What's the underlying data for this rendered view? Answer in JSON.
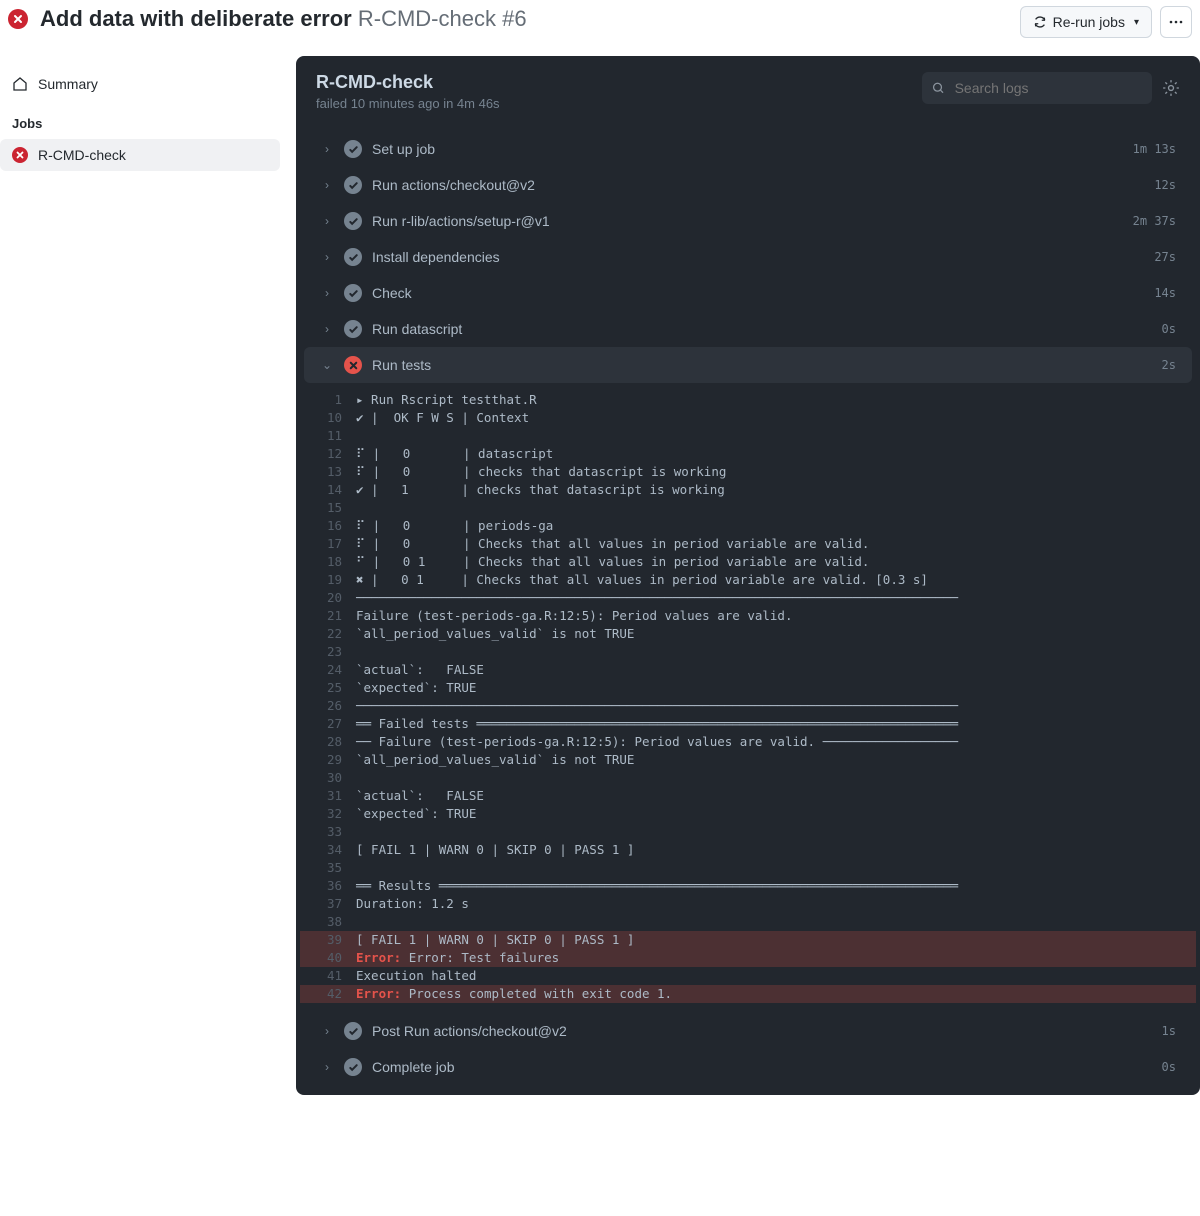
{
  "header": {
    "title": "Add data with deliberate error",
    "subtitle": "R-CMD-check #6",
    "rerun_label": "Re-run jobs"
  },
  "sidebar": {
    "summary_label": "Summary",
    "jobs_label": "Jobs",
    "items": [
      {
        "label": "R-CMD-check",
        "status": "fail"
      }
    ]
  },
  "toolbar": {
    "title": "R-CMD-check",
    "subtitle": "failed 10 minutes ago in 4m 46s",
    "search_placeholder": "Search logs"
  },
  "steps": [
    {
      "name": "Set up job",
      "time": "1m 13s",
      "status": "ok"
    },
    {
      "name": "Run actions/checkout@v2",
      "time": "12s",
      "status": "ok"
    },
    {
      "name": "Run r-lib/actions/setup-r@v1",
      "time": "2m 37s",
      "status": "ok"
    },
    {
      "name": "Install dependencies",
      "time": "27s",
      "status": "ok"
    },
    {
      "name": "Check",
      "time": "14s",
      "status": "ok"
    },
    {
      "name": "Run datascript",
      "time": "0s",
      "status": "ok"
    },
    {
      "name": "Run tests",
      "time": "2s",
      "status": "fail",
      "open": true
    },
    {
      "name": "Post Run actions/checkout@v2",
      "time": "1s",
      "status": "ok"
    },
    {
      "name": "Complete job",
      "time": "0s",
      "status": "ok"
    }
  ],
  "log": [
    {
      "n": 1,
      "t": "▸ Run Rscript testthat.R"
    },
    {
      "n": 10,
      "t": "✔ |  OK F W S | Context"
    },
    {
      "n": 11,
      "t": ""
    },
    {
      "n": 12,
      "t": "⠏ |   0       | datascript"
    },
    {
      "n": 13,
      "t": "⠏ |   0       | checks that datascript is working"
    },
    {
      "n": 14,
      "t": "✔ |   1       | checks that datascript is working"
    },
    {
      "n": 15,
      "t": ""
    },
    {
      "n": 16,
      "t": "⠏ |   0       | periods-ga"
    },
    {
      "n": 17,
      "t": "⠏ |   0       | Checks that all values in period variable are valid."
    },
    {
      "n": 18,
      "t": "⠋ |   0 1     | Checks that all values in period variable are valid."
    },
    {
      "n": 19,
      "t": "✖ |   0 1     | Checks that all values in period variable are valid. [0.3 s]"
    },
    {
      "n": 20,
      "t": "────────────────────────────────────────────────────────────────────────────────"
    },
    {
      "n": 21,
      "t": "Failure (test-periods-ga.R:12:5): Period values are valid."
    },
    {
      "n": 22,
      "t": "`all_period_values_valid` is not TRUE"
    },
    {
      "n": 23,
      "t": ""
    },
    {
      "n": 24,
      "t": "`actual`:   FALSE"
    },
    {
      "n": 25,
      "t": "`expected`: TRUE "
    },
    {
      "n": 26,
      "t": "────────────────────────────────────────────────────────────────────────────────"
    },
    {
      "n": 27,
      "t": "══ Failed tests ════════════════════════════════════════════════════════════════"
    },
    {
      "n": 28,
      "t": "── Failure (test-periods-ga.R:12:5): Period values are valid. ──────────────────"
    },
    {
      "n": 29,
      "t": "`all_period_values_valid` is not TRUE"
    },
    {
      "n": 30,
      "t": ""
    },
    {
      "n": 31,
      "t": "`actual`:   FALSE"
    },
    {
      "n": 32,
      "t": "`expected`: TRUE "
    },
    {
      "n": 33,
      "t": ""
    },
    {
      "n": 34,
      "t": "[ FAIL 1 | WARN 0 | SKIP 0 | PASS 1 ]"
    },
    {
      "n": 35,
      "t": ""
    },
    {
      "n": 36,
      "t": "══ Results ═════════════════════════════════════════════════════════════════════"
    },
    {
      "n": 37,
      "t": "Duration: 1.2 s"
    },
    {
      "n": 38,
      "t": ""
    },
    {
      "n": 39,
      "t": "[ FAIL 1 | WARN 0 | SKIP 0 | PASS 1 ]",
      "err": true
    },
    {
      "n": 40,
      "t": "Error: Test failures",
      "err": true,
      "prefix": "Error:"
    },
    {
      "n": 41,
      "t": "Execution halted"
    },
    {
      "n": 42,
      "t": "Process completed with exit code 1.",
      "err": true,
      "prefix": "Error:"
    }
  ]
}
